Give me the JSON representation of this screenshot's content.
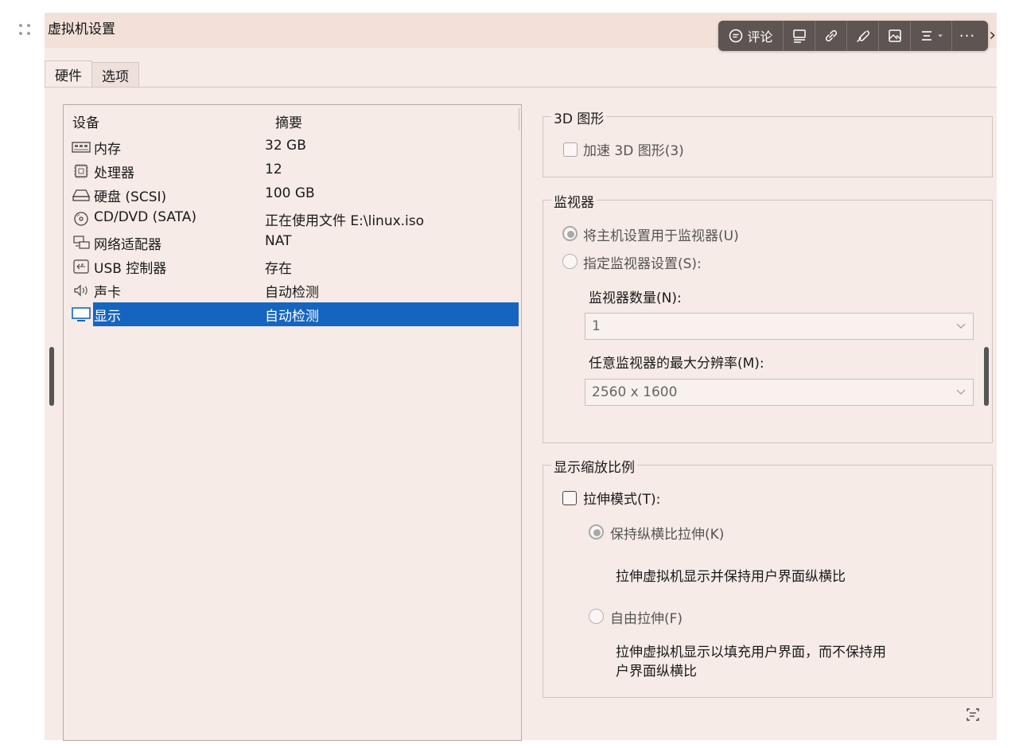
{
  "window": {
    "title": "虚拟机设置"
  },
  "toolbar": {
    "comment_label": "评论",
    "items": [
      "comment-icon",
      "caption-icon",
      "link-icon",
      "attachment-icon",
      "image-icon",
      "align-icon",
      "more-icon"
    ],
    "more_label": "···",
    "accent_color": "#5e5553"
  },
  "tabs": [
    {
      "label": "硬件",
      "active": true
    },
    {
      "label": "选项",
      "active": false
    }
  ],
  "devices": {
    "col_device": "设备",
    "col_summary": "摘要",
    "rows": [
      {
        "icon": "memory-icon",
        "name": "内存",
        "summary": "32 GB"
      },
      {
        "icon": "processor-icon",
        "name": "处理器",
        "summary": "12"
      },
      {
        "icon": "harddisk-icon",
        "name": "硬盘 (SCSI)",
        "summary": "100 GB"
      },
      {
        "icon": "cd-dvd-icon",
        "name": "CD/DVD (SATA)",
        "summary": "正在使用文件 E:\\linux.iso"
      },
      {
        "icon": "network-icon",
        "name": "网络适配器",
        "summary": "NAT"
      },
      {
        "icon": "usb-icon",
        "name": "USB 控制器",
        "summary": "存在"
      },
      {
        "icon": "sound-icon",
        "name": "声卡",
        "summary": "自动检测"
      },
      {
        "icon": "display-icon",
        "name": "显示",
        "summary": "自动检测",
        "selected": true
      }
    ],
    "selected_color": "#1565c0"
  },
  "graphics3d": {
    "legend": "3D 图形",
    "accelerate_label": "加速 3D 图形(3)",
    "accelerate_checked": false
  },
  "monitor": {
    "legend": "监视器",
    "use_host_label": "将主机设置用于监视器(U)",
    "use_host_selected": true,
    "specify_label": "指定监视器设置(S):",
    "specify_selected": false,
    "count_label": "监视器数量(N):",
    "count_value": "1",
    "max_res_label": "任意监视器的最大分辨率(M):",
    "max_res_value": "2560 x 1600"
  },
  "scaling": {
    "legend": "显示缩放比例",
    "stretch_label": "拉伸模式(T):",
    "stretch_checked": false,
    "keep_ratio_label": "保持纵横比拉伸(K)",
    "keep_ratio_selected": true,
    "keep_ratio_desc": "拉伸虚拟机显示并保持用户界面纵横比",
    "free_label": "自由拉伸(F)",
    "free_selected": false,
    "free_desc_line1": "拉伸虚拟机显示以填充用户界面，而不保持用",
    "free_desc_line2": "户界面纵横比"
  }
}
